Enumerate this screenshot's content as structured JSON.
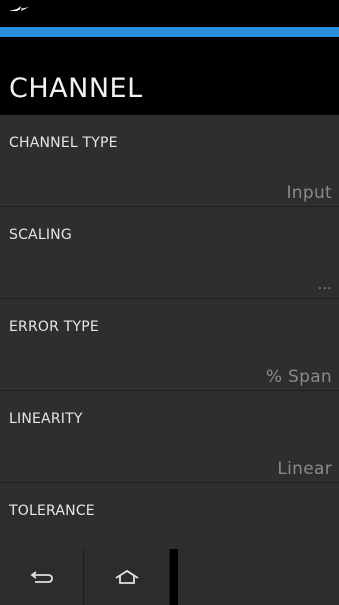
{
  "status_bar": {
    "icon": "plug-icon"
  },
  "header": {
    "title": "CHANNEL",
    "accent_color": "#2a8fdf"
  },
  "settings": {
    "items": [
      {
        "label": "CHANNEL TYPE",
        "value": "Input"
      },
      {
        "label": "SCALING",
        "value": "..."
      },
      {
        "label": "ERROR TYPE",
        "value": "% Span"
      },
      {
        "label": "LINEARITY",
        "value": "Linear"
      },
      {
        "label": "TOLERANCE",
        "value": ""
      }
    ]
  },
  "nav": {
    "back_icon": "back-arrow-icon",
    "home_icon": "home-icon"
  }
}
